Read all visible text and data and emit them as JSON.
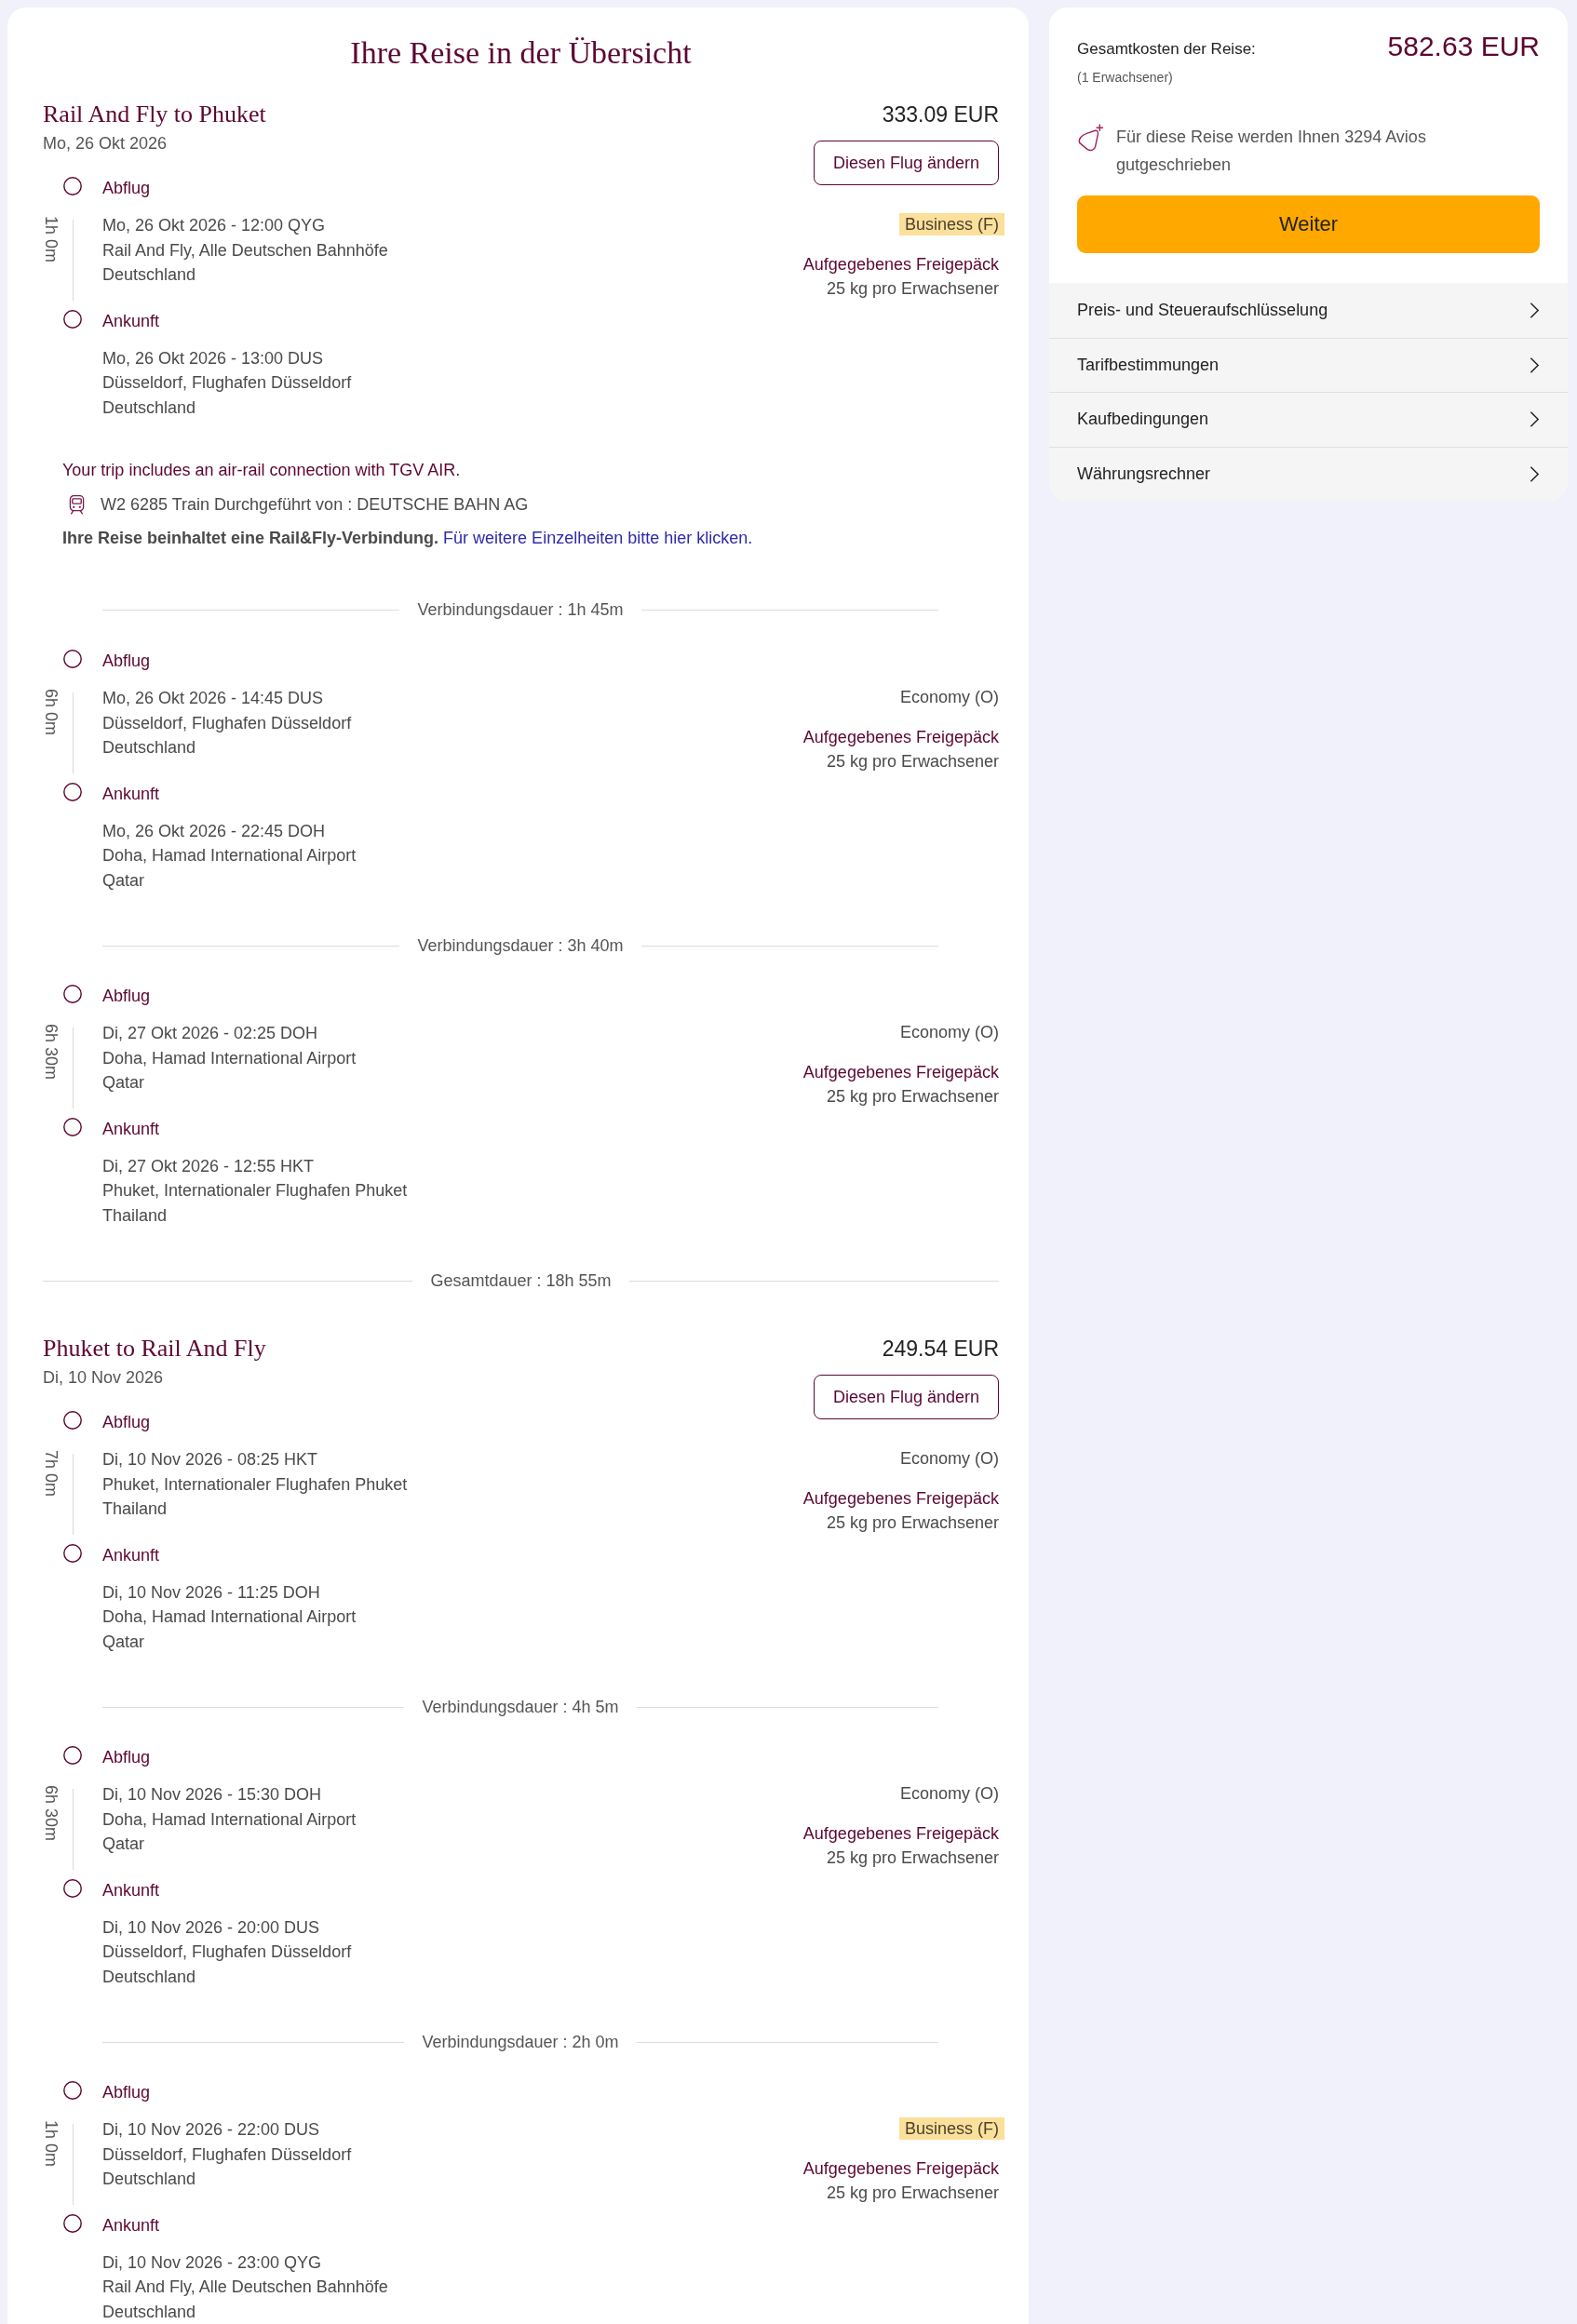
{
  "page_title": "Ihre Reise in der Übersicht",
  "segments": [
    {
      "title": "Rail And Fly to Phuket",
      "price": "333.09 EUR",
      "date": "Mo, 26 Okt 2026",
      "change_button": "Diesen Flug ändern",
      "items": [
        {
          "kind": "leg",
          "duration": "1h 0m",
          "departure": {
            "label": "Abflug",
            "lines": [
              "Mo, 26 Okt 2026 - 12:00 QYG",
              "Rail And Fly, Alle Deutschen Bahnhöfe",
              "Deutschland"
            ]
          },
          "arrival": {
            "label": "Ankunft",
            "lines": [
              "Mo, 26 Okt 2026 - 13:00 DUS",
              "Düsseldorf, Flughafen Düsseldorf",
              "Deutschland"
            ]
          },
          "cabin": {
            "label": "Business (F)",
            "highlighted": true
          },
          "baggage": {
            "title": "Aufgegebenes Freigepäck",
            "allowance": "25 kg pro Erwachsener"
          }
        },
        {
          "kind": "rail_note",
          "notice": "Your trip includes an air-rail connection with TGV AIR.",
          "train": "W2 6285 Train Durchgeführt von : DEUTSCHE BAHN AG",
          "info": "Ihre Reise beinhaltet eine Rail&Fly-Verbindung.",
          "link": "Für weitere Einzelheiten bitte hier klicken."
        },
        {
          "kind": "connection",
          "label": "Verbindungsdauer : 1h 45m"
        },
        {
          "kind": "leg",
          "duration": "6h 0m",
          "departure": {
            "label": "Abflug",
            "lines": [
              "Mo, 26 Okt 2026 - 14:45 DUS",
              "Düsseldorf, Flughafen Düsseldorf",
              "Deutschland"
            ]
          },
          "arrival": {
            "label": "Ankunft",
            "lines": [
              "Mo, 26 Okt 2026 - 22:45 DOH",
              "Doha, Hamad International Airport",
              "Qatar"
            ]
          },
          "cabin": {
            "label": "Economy (O)",
            "highlighted": false
          },
          "baggage": {
            "title": "Aufgegebenes Freigepäck",
            "allowance": "25 kg pro Erwachsener"
          }
        },
        {
          "kind": "connection",
          "label": "Verbindungsdauer : 3h 40m"
        },
        {
          "kind": "leg",
          "duration": "6h 30m",
          "departure": {
            "label": "Abflug",
            "lines": [
              "Di, 27 Okt 2026 - 02:25 DOH",
              "Doha, Hamad International Airport",
              "Qatar"
            ]
          },
          "arrival": {
            "label": "Ankunft",
            "lines": [
              "Di, 27 Okt 2026 - 12:55 HKT",
              "Phuket, Internationaler Flughafen Phuket",
              "Thailand"
            ]
          },
          "cabin": {
            "label": "Economy (O)",
            "highlighted": false
          },
          "baggage": {
            "title": "Aufgegebenes Freigepäck",
            "allowance": "25 kg pro Erwachsener"
          }
        }
      ],
      "total_duration": "Gesamtdauer : 18h 55m"
    },
    {
      "title": "Phuket to Rail And Fly",
      "price": "249.54 EUR",
      "date": "Di, 10 Nov 2026",
      "change_button": "Diesen Flug ändern",
      "items": [
        {
          "kind": "leg",
          "duration": "7h 0m",
          "departure": {
            "label": "Abflug",
            "lines": [
              "Di, 10 Nov 2026 - 08:25 HKT",
              "Phuket, Internationaler Flughafen Phuket",
              "Thailand"
            ]
          },
          "arrival": {
            "label": "Ankunft",
            "lines": [
              "Di, 10 Nov 2026 - 11:25 DOH",
              "Doha, Hamad International Airport",
              "Qatar"
            ]
          },
          "cabin": {
            "label": "Economy (O)",
            "highlighted": false
          },
          "baggage": {
            "title": "Aufgegebenes Freigepäck",
            "allowance": "25 kg pro Erwachsener"
          }
        },
        {
          "kind": "connection",
          "label": "Verbindungsdauer : 4h 5m"
        },
        {
          "kind": "leg",
          "duration": "6h 30m",
          "departure": {
            "label": "Abflug",
            "lines": [
              "Di, 10 Nov 2026 - 15:30 DOH",
              "Doha, Hamad International Airport",
              "Qatar"
            ]
          },
          "arrival": {
            "label": "Ankunft",
            "lines": [
              "Di, 10 Nov 2026 - 20:00 DUS",
              "Düsseldorf, Flughafen Düsseldorf",
              "Deutschland"
            ]
          },
          "cabin": {
            "label": "Economy (O)",
            "highlighted": false
          },
          "baggage": {
            "title": "Aufgegebenes Freigepäck",
            "allowance": "25 kg pro Erwachsener"
          }
        },
        {
          "kind": "connection",
          "label": "Verbindungsdauer : 2h 0m"
        },
        {
          "kind": "leg",
          "duration": "1h 0m",
          "departure": {
            "label": "Abflug",
            "lines": [
              "Di, 10 Nov 2026 - 22:00 DUS",
              "Düsseldorf, Flughafen Düsseldorf",
              "Deutschland"
            ]
          },
          "arrival": {
            "label": "Ankunft",
            "lines": [
              "Di, 10 Nov 2026 - 23:00 QYG",
              "Rail And Fly, Alle Deutschen Bahnhöfe",
              "Deutschland"
            ]
          },
          "cabin": {
            "label": "Business (F)",
            "highlighted": true
          },
          "baggage": {
            "title": "Aufgegebenes Freigepäck",
            "allowance": "25 kg pro Erwachsener"
          }
        }
      ]
    }
  ],
  "summary": {
    "total_label": "Gesamtkosten der Reise:",
    "travellers": "(1 Erwachsener)",
    "total_price": "582.63 EUR",
    "avios_note": "Für diese Reise werden Ihnen 3294 Avios gutgeschrieben",
    "continue_button": "Weiter",
    "links": [
      "Preis- und Steueraufschlüsselung",
      "Tarifbestimmungen",
      "Kaufbedingungen",
      "Währungsrechner"
    ]
  }
}
